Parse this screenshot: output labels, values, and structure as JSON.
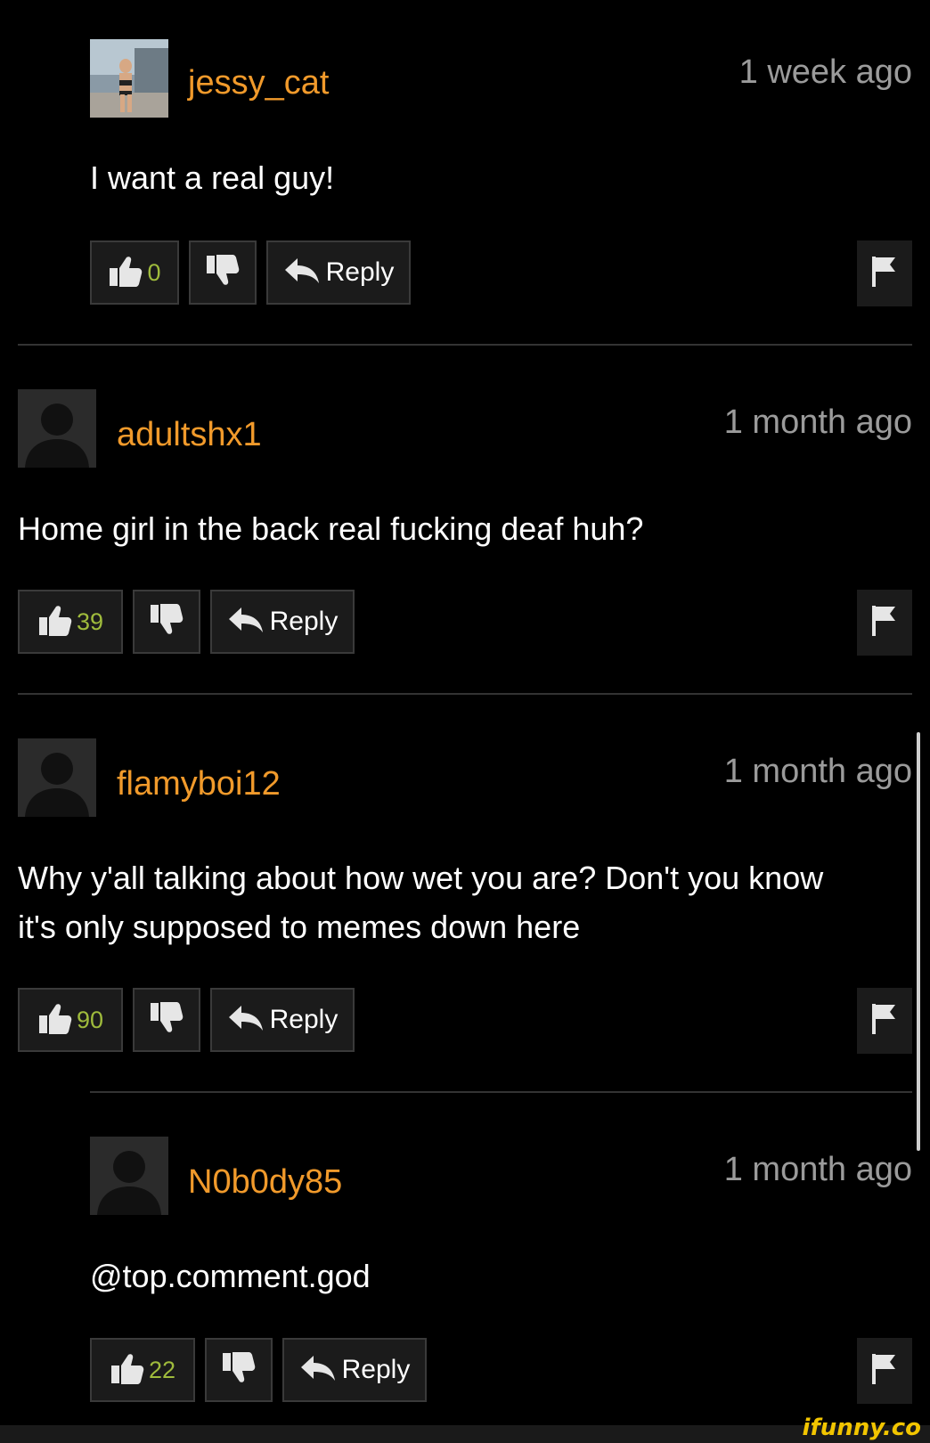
{
  "comments": [
    {
      "username": "jessy_cat",
      "time": "1 week ago",
      "text": "I want a real guy!",
      "likes": "0",
      "reply_label": "Reply",
      "avatar": "photo"
    },
    {
      "username": "adultshx1",
      "time": "1 month ago",
      "text": "Home girl in the back real fucking deaf huh?",
      "likes": "39",
      "reply_label": "Reply",
      "avatar": "default"
    },
    {
      "username": "flamyboi12",
      "time": "1 month ago",
      "text": "Why y'all talking about how wet you are? Don't you know it's only supposed to memes down here",
      "likes": "90",
      "reply_label": "Reply",
      "avatar": "default"
    },
    {
      "username": "N0b0dy85",
      "time": "1 month ago",
      "text": "@top.comment.god",
      "likes": "22",
      "reply_label": "Reply",
      "avatar": "default"
    }
  ],
  "icons": {
    "like": "thumbs-up-icon",
    "dislike": "thumbs-down-icon",
    "reply": "reply-arrow-icon",
    "flag": "flag-icon"
  },
  "colors": {
    "background": "#000000",
    "username": "#f19a2b",
    "time": "#9b9b9b",
    "like_count": "#9fbb3c"
  },
  "watermark": "ifunny.co"
}
